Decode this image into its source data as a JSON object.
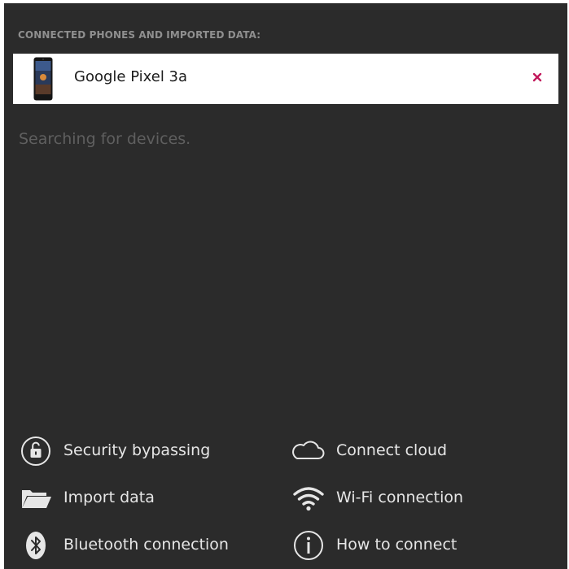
{
  "section_title": "CONNECTED PHONES AND IMPORTED DATA:",
  "device": {
    "name": "Google Pixel 3a",
    "remove_label": "×",
    "thumbnail_icon": "phone-icon"
  },
  "status": "Searching for devices.",
  "actions": [
    {
      "label": "Security bypassing",
      "icon": "unlock-icon"
    },
    {
      "label": "Connect cloud",
      "icon": "cloud-icon"
    },
    {
      "label": "Import data",
      "icon": "folder-icon"
    },
    {
      "label": "Wi-Fi connection",
      "icon": "wifi-icon"
    },
    {
      "label": "Bluetooth connection",
      "icon": "bluetooth-icon"
    },
    {
      "label": "How to connect",
      "icon": "info-icon"
    }
  ],
  "colors": {
    "panel_background": "#2b2b2b",
    "remove_accent": "#c2185b",
    "muted_text": "#5f5f5f",
    "title_text": "#8f8f8f"
  }
}
